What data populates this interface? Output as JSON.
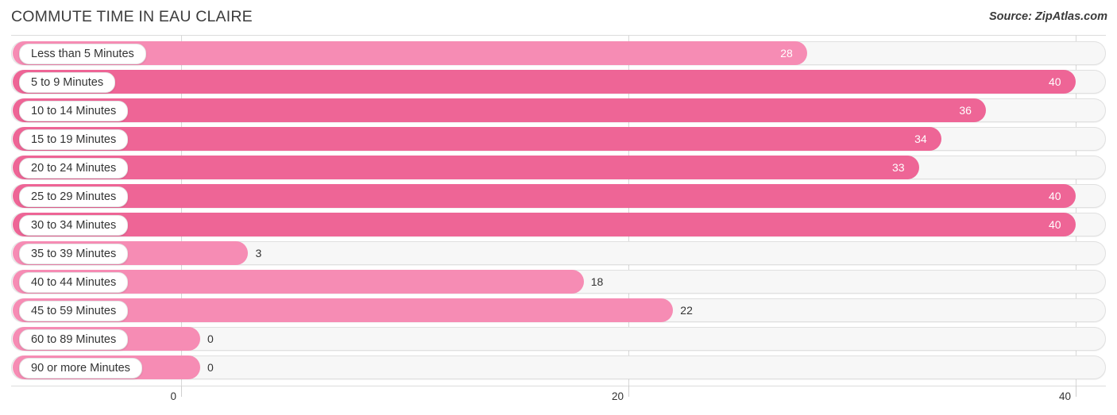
{
  "header": {
    "title": "COMMUTE TIME IN EAU CLAIRE",
    "source": "Source: ZipAtlas.com"
  },
  "colors": {
    "bar_light": "#F68CB4",
    "bar_dark": "#EE6596",
    "track_fill": "#F7F7F7",
    "track_border": "#E0E0E0",
    "label_text": "#333333",
    "value_in_text": "#FFFFFF"
  },
  "chart_data": {
    "type": "bar",
    "orientation": "horizontal",
    "title": "COMMUTE TIME IN EAU CLAIRE",
    "xlabel": "",
    "ylabel": "",
    "xlim": [
      0,
      40
    ],
    "grid": true,
    "xticks": [
      {
        "label": "0",
        "value": 0
      },
      {
        "label": "20",
        "value": 20
      },
      {
        "label": "40",
        "value": 40
      }
    ],
    "categories": [
      "Less than 5 Minutes",
      "5 to 9 Minutes",
      "10 to 14 Minutes",
      "15 to 19 Minutes",
      "20 to 24 Minutes",
      "25 to 29 Minutes",
      "30 to 34 Minutes",
      "35 to 39 Minutes",
      "40 to 44 Minutes",
      "45 to 59 Minutes",
      "60 to 89 Minutes",
      "90 or more Minutes"
    ],
    "values": [
      28,
      40,
      36,
      34,
      33,
      40,
      40,
      3,
      18,
      22,
      0,
      0
    ],
    "value_labels": [
      "28",
      "40",
      "36",
      "34",
      "33",
      "40",
      "40",
      "3",
      "18",
      "22",
      "0",
      "0"
    ],
    "bar_colors": [
      "#F68CB4",
      "#EE6596",
      "#EE6596",
      "#EE6596",
      "#EE6596",
      "#EE6596",
      "#EE6596",
      "#F68CB4",
      "#F68CB4",
      "#F68CB4",
      "#F68CB4",
      "#F68CB4"
    ],
    "label_inside": [
      true,
      true,
      true,
      true,
      true,
      true,
      true,
      false,
      false,
      false,
      false,
      false
    ]
  }
}
